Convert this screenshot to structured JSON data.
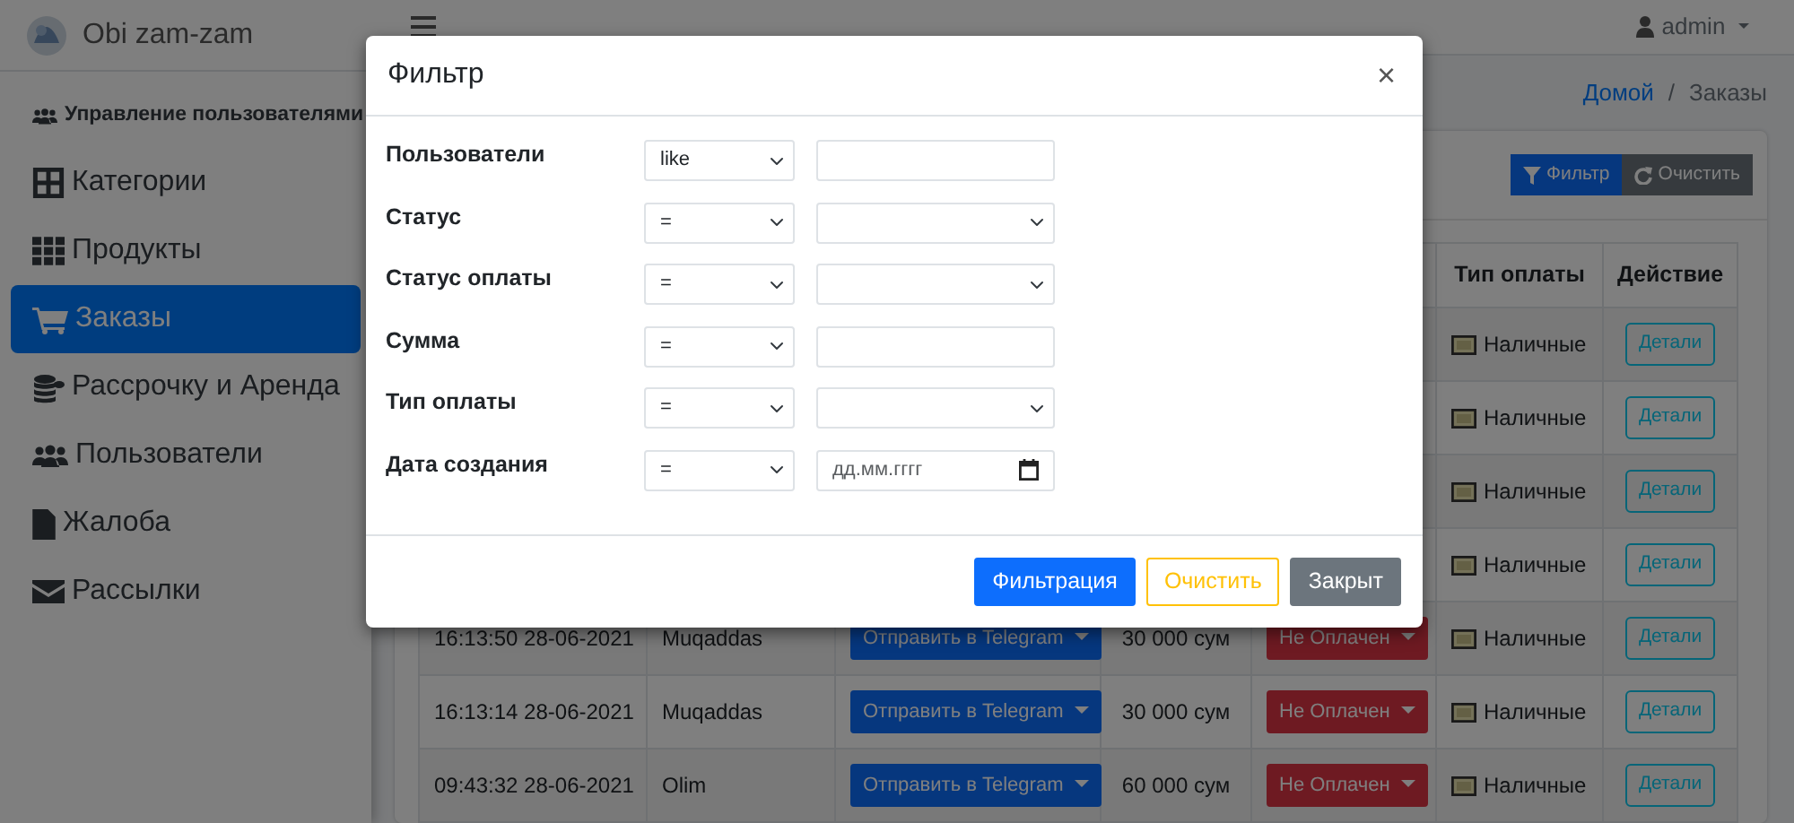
{
  "sidebar": {
    "brand": "Obi zam-zam",
    "items": [
      {
        "label": "Управление пользователями",
        "kind": "section",
        "selected": false
      },
      {
        "label": "Категории",
        "kind": "link",
        "selected": false
      },
      {
        "label": "Продукты",
        "kind": "link",
        "selected": false
      },
      {
        "label": "Заказы",
        "kind": "link",
        "selected": true
      },
      {
        "label": "Рассрочку и Аренда",
        "kind": "link",
        "selected": false
      },
      {
        "label": "Пользователи",
        "kind": "link",
        "selected": false
      },
      {
        "label": "Жалоба",
        "kind": "link",
        "selected": false
      },
      {
        "label": "Рассылки",
        "kind": "link",
        "selected": false
      }
    ]
  },
  "navbar": {
    "user": "admin"
  },
  "breadcrumb": {
    "separator": "/",
    "items": [
      {
        "label": "Домой",
        "selected": false
      },
      {
        "label": "Заказы",
        "selected": true
      }
    ]
  },
  "toolbar": [
    {
      "label": "Фильтр",
      "kind": "primary"
    },
    {
      "label": "Очистить",
      "kind": "secondary"
    }
  ],
  "table": {
    "columns": [
      null,
      null,
      null,
      null,
      null,
      "Тип оплаты",
      "Действие"
    ],
    "rows": [
      {
        "payment": "Наличные",
        "action": "Детали"
      },
      {
        "payment": "Наличные",
        "action": "Детали"
      },
      {
        "payment": "Наличные",
        "action": "Детали"
      },
      {
        "payment": "Наличные",
        "action": "Детали"
      },
      {
        "time": "16:13:50 28-06-2021",
        "user": "Muqaddas",
        "telegram": "Отправить в Telegram",
        "sum": "30 000 сум",
        "status": "Не Оплачен",
        "payment": "Наличные",
        "action": "Детали"
      },
      {
        "time": "16:13:14 28-06-2021",
        "user": "Muqaddas",
        "telegram": "Отправить в Telegram",
        "sum": "30 000 сум",
        "status": "Не Оплачен",
        "payment": "Наличные",
        "action": "Детали"
      },
      {
        "time": "09:43:32 28-06-2021",
        "user": "Olim",
        "telegram": "Отправить в Telegram",
        "sum": "60 000 сум",
        "status": "Не Оплачен",
        "payment": "Наличные",
        "action": "Детали"
      }
    ]
  },
  "modal": {
    "title": "Фильтр",
    "close": "×",
    "fields": [
      {
        "label": "Пользователи",
        "operator": "like",
        "kind": "text"
      },
      {
        "label": "Статус",
        "operator": "=",
        "kind": "select"
      },
      {
        "label": "Статус оплаты",
        "operator": "=",
        "kind": "select"
      },
      {
        "label": "Сумма",
        "operator": "=",
        "kind": "text"
      },
      {
        "label": "Тип оплаты",
        "operator": "=",
        "kind": "select"
      },
      {
        "label": "Дата создания",
        "operator": "=",
        "kind": "date",
        "placeholder": "дд.мм.гггг"
      }
    ],
    "buttons": [
      {
        "label": "Фильтрация",
        "kind": "primary"
      },
      {
        "label": "Очистить",
        "kind": "outline-warning"
      },
      {
        "label": "Закрыт",
        "kind": "secondary"
      }
    ]
  }
}
